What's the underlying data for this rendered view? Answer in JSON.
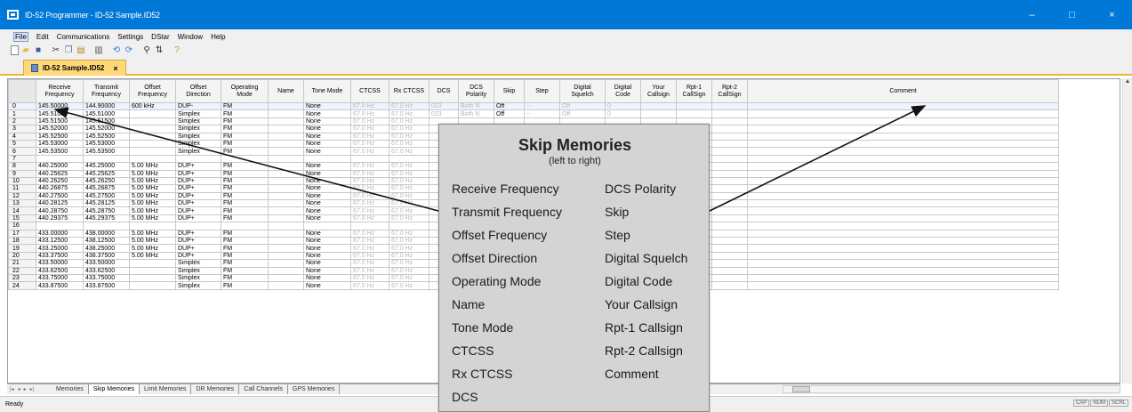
{
  "window": {
    "title": "ID-52 Programmer - ID-52 Sample.ID52",
    "minimize": "–",
    "maximize": "□",
    "close": "×"
  },
  "menu": [
    "File",
    "Edit",
    "Communications",
    "Settings",
    "DStar",
    "Window",
    "Help"
  ],
  "toolbar": [
    "new-icon",
    "open-icon",
    "save-icon",
    "cut-icon",
    "copy-icon",
    "paste-icon",
    "print-icon",
    "read-icon",
    "write-icon",
    "find-icon",
    "sort-icon",
    "help-icon"
  ],
  "doc_tab": {
    "label": "ID-52 Sample.ID52",
    "close": "×"
  },
  "grid": {
    "columns": [
      "Receive Frequency",
      "Transmit Frequency",
      "Offset Frequency",
      "Offset Direction",
      "Operating Mode",
      "Name",
      "Tone Mode",
      "CTCSS",
      "Rx CTCSS",
      "DCS",
      "DCS Polarity",
      "Skip",
      "Step",
      "Digital Squelch",
      "Digital Code",
      "Your Callsign",
      "Rpt-1 CallSign",
      "Rpt-2 CallSign",
      "Comment"
    ],
    "rows": [
      {
        "n": "0",
        "rx": "145.50000",
        "tx": "144.90000",
        "off": "600 kHz",
        "dir": "DUP-",
        "mode": "FM",
        "tone": "None",
        "ctcss": "67.0 Hz",
        "rxctcss": "67.0 Hz",
        "dcs": "023",
        "pol": "Both N",
        "skip": "Off",
        "step": "--",
        "dsq": "Off",
        "dcode": "0"
      },
      {
        "n": "1",
        "rx": "145.51000",
        "tx": "145.51000",
        "off": "",
        "dir": "Simplex",
        "mode": "FM",
        "tone": "None",
        "ctcss": "67.0 Hz",
        "rxctcss": "67.0 Hz",
        "dcs": "023",
        "pol": "Both N",
        "skip": "Off",
        "step": "--",
        "dsq": "Off",
        "dcode": "0"
      },
      {
        "n": "2",
        "rx": "145.51500",
        "tx": "145.51500",
        "off": "",
        "dir": "Simplex",
        "mode": "FM",
        "tone": "None",
        "ctcss": "67.0 Hz",
        "rxctcss": "67.0 Hz",
        "dcs": "",
        "pol": "",
        "skip": "",
        "step": "",
        "dsq": "",
        "dcode": ""
      },
      {
        "n": "3",
        "rx": "145.52000",
        "tx": "145.52000",
        "off": "",
        "dir": "Simplex",
        "mode": "FM",
        "tone": "None",
        "ctcss": "67.0 Hz",
        "rxctcss": "67.0 Hz",
        "dcs": "",
        "pol": "",
        "skip": "",
        "step": "",
        "dsq": "",
        "dcode": ""
      },
      {
        "n": "4",
        "rx": "145.52500",
        "tx": "145.52500",
        "off": "",
        "dir": "Simplex",
        "mode": "FM",
        "tone": "None",
        "ctcss": "67.0 Hz",
        "rxctcss": "67.0 Hz",
        "dcs": "",
        "pol": "",
        "skip": "",
        "step": "",
        "dsq": "",
        "dcode": ""
      },
      {
        "n": "5",
        "rx": "145.53000",
        "tx": "145.53000",
        "off": "",
        "dir": "Simplex",
        "mode": "FM",
        "tone": "None",
        "ctcss": "67.0 Hz",
        "rxctcss": "67.0 Hz",
        "dcs": "",
        "pol": "",
        "skip": "",
        "step": "",
        "dsq": "",
        "dcode": ""
      },
      {
        "n": "6",
        "rx": "145.53500",
        "tx": "145.53500",
        "off": "",
        "dir": "Simplex",
        "mode": "FM",
        "tone": "None",
        "ctcss": "67.0 Hz",
        "rxctcss": "67.0 Hz",
        "dcs": "",
        "pol": "",
        "skip": "",
        "step": "",
        "dsq": "",
        "dcode": ""
      },
      {
        "n": "7",
        "rx": "",
        "tx": "",
        "off": "",
        "dir": "",
        "mode": "",
        "tone": "",
        "ctcss": "",
        "rxctcss": "",
        "dcs": "",
        "pol": "",
        "skip": "",
        "step": "",
        "dsq": "",
        "dcode": ""
      },
      {
        "n": "8",
        "rx": "440.25000",
        "tx": "445.25000",
        "off": "5.00 MHz",
        "dir": "DUP+",
        "mode": "FM",
        "tone": "None",
        "ctcss": "67.0 Hz",
        "rxctcss": "67.0 Hz",
        "dcs": "",
        "pol": "",
        "skip": "",
        "step": "",
        "dsq": "",
        "dcode": ""
      },
      {
        "n": "9",
        "rx": "440.25625",
        "tx": "445.25625",
        "off": "5.00 MHz",
        "dir": "DUP+",
        "mode": "FM",
        "tone": "None",
        "ctcss": "67.0 Hz",
        "rxctcss": "67.0 Hz",
        "dcs": "",
        "pol": "",
        "skip": "",
        "step": "",
        "dsq": "",
        "dcode": ""
      },
      {
        "n": "10",
        "rx": "440.26250",
        "tx": "445.26250",
        "off": "5.00 MHz",
        "dir": "DUP+",
        "mode": "FM",
        "tone": "None",
        "ctcss": "67.0 Hz",
        "rxctcss": "67.0 Hz",
        "dcs": "",
        "pol": "",
        "skip": "",
        "step": "",
        "dsq": "",
        "dcode": ""
      },
      {
        "n": "11",
        "rx": "440.26875",
        "tx": "445.26875",
        "off": "5.00 MHz",
        "dir": "DUP+",
        "mode": "FM",
        "tone": "None",
        "ctcss": "67.0 Hz",
        "rxctcss": "67.0 Hz",
        "dcs": "",
        "pol": "",
        "skip": "",
        "step": "",
        "dsq": "",
        "dcode": ""
      },
      {
        "n": "12",
        "rx": "440.27500",
        "tx": "445.27500",
        "off": "5.00 MHz",
        "dir": "DUP+",
        "mode": "FM",
        "tone": "None",
        "ctcss": "67.0 Hz",
        "rxctcss": "67.0 Hz",
        "dcs": "",
        "pol": "",
        "skip": "",
        "step": "",
        "dsq": "",
        "dcode": ""
      },
      {
        "n": "13",
        "rx": "440.28125",
        "tx": "445.28125",
        "off": "5.00 MHz",
        "dir": "DUP+",
        "mode": "FM",
        "tone": "None",
        "ctcss": "67.0 Hz",
        "rxctcss": "67.0 Hz",
        "dcs": "",
        "pol": "",
        "skip": "",
        "step": "",
        "dsq": "",
        "dcode": ""
      },
      {
        "n": "14",
        "rx": "440.28750",
        "tx": "445.28750",
        "off": "5.00 MHz",
        "dir": "DUP+",
        "mode": "FM",
        "tone": "None",
        "ctcss": "67.0 Hz",
        "rxctcss": "67.0 Hz",
        "dcs": "",
        "pol": "",
        "skip": "",
        "step": "",
        "dsq": "",
        "dcode": ""
      },
      {
        "n": "15",
        "rx": "440.29375",
        "tx": "445.29375",
        "off": "5.00 MHz",
        "dir": "DUP+",
        "mode": "FM",
        "tone": "None",
        "ctcss": "67.0 Hz",
        "rxctcss": "67.0 Hz",
        "dcs": "",
        "pol": "",
        "skip": "",
        "step": "",
        "dsq": "",
        "dcode": ""
      },
      {
        "n": "16",
        "rx": "",
        "tx": "",
        "off": "",
        "dir": "",
        "mode": "",
        "tone": "",
        "ctcss": "",
        "rxctcss": "",
        "dcs": "",
        "pol": "",
        "skip": "",
        "step": "",
        "dsq": "",
        "dcode": ""
      },
      {
        "n": "17",
        "rx": "433.00000",
        "tx": "438.00000",
        "off": "5.00 MHz",
        "dir": "DUP+",
        "mode": "FM",
        "tone": "None",
        "ctcss": "67.0 Hz",
        "rxctcss": "67.0 Hz",
        "dcs": "",
        "pol": "",
        "skip": "",
        "step": "",
        "dsq": "",
        "dcode": ""
      },
      {
        "n": "18",
        "rx": "433.12500",
        "tx": "438.12500",
        "off": "5.00 MHz",
        "dir": "DUP+",
        "mode": "FM",
        "tone": "None",
        "ctcss": "67.0 Hz",
        "rxctcss": "67.0 Hz",
        "dcs": "",
        "pol": "",
        "skip": "",
        "step": "",
        "dsq": "",
        "dcode": ""
      },
      {
        "n": "19",
        "rx": "433.25000",
        "tx": "438.25000",
        "off": "5.00 MHz",
        "dir": "DUP+",
        "mode": "FM",
        "tone": "None",
        "ctcss": "67.0 Hz",
        "rxctcss": "67.0 Hz",
        "dcs": "",
        "pol": "",
        "skip": "",
        "step": "",
        "dsq": "",
        "dcode": ""
      },
      {
        "n": "20",
        "rx": "433.37500",
        "tx": "438.37500",
        "off": "5.00 MHz",
        "dir": "DUP+",
        "mode": "FM",
        "tone": "None",
        "ctcss": "67.0 Hz",
        "rxctcss": "67.0 Hz",
        "dcs": "",
        "pol": "",
        "skip": "",
        "step": "",
        "dsq": "",
        "dcode": ""
      },
      {
        "n": "21",
        "rx": "433.50000",
        "tx": "433.50000",
        "off": "",
        "dir": "Simplex",
        "mode": "FM",
        "tone": "None",
        "ctcss": "67.0 Hz",
        "rxctcss": "67.0 Hz",
        "dcs": "",
        "pol": "",
        "skip": "",
        "step": "",
        "dsq": "",
        "dcode": ""
      },
      {
        "n": "22",
        "rx": "433.62500",
        "tx": "433.62500",
        "off": "",
        "dir": "Simplex",
        "mode": "FM",
        "tone": "None",
        "ctcss": "67.0 Hz",
        "rxctcss": "67.0 Hz",
        "dcs": "",
        "pol": "",
        "skip": "",
        "step": "",
        "dsq": "",
        "dcode": ""
      },
      {
        "n": "23",
        "rx": "433.75000",
        "tx": "433.75000",
        "off": "",
        "dir": "Simplex",
        "mode": "FM",
        "tone": "None",
        "ctcss": "67.0 Hz",
        "rxctcss": "67.0 Hz",
        "dcs": "",
        "pol": "",
        "skip": "",
        "step": "",
        "dsq": "",
        "dcode": ""
      },
      {
        "n": "24",
        "rx": "433.87500",
        "tx": "433.87500",
        "off": "",
        "dir": "Simplex",
        "mode": "FM",
        "tone": "None",
        "ctcss": "67.0 Hz",
        "rxctcss": "67.0 Hz",
        "dcs": "",
        "pol": "",
        "skip": "",
        "step": "",
        "dsq": "",
        "dcode": ""
      }
    ]
  },
  "sheet_tabs": {
    "nav": [
      "|◂",
      "◂",
      "▸",
      "▸|"
    ],
    "tabs": [
      "Memories",
      "Skip Memories",
      "Limit Memories",
      "DR Memories",
      "Call Channels",
      "GPS Memories"
    ],
    "active": 1
  },
  "status": {
    "text": "Ready",
    "indicators": [
      "CAP",
      "NUM",
      "SCRL"
    ]
  },
  "overlay": {
    "title": "Skip Memories",
    "subtitle": "(left to right)",
    "left": [
      "Receive Frequency",
      "Transmit Frequency",
      "Offset Frequency",
      "Offset Direction",
      "Operating Mode",
      "Name",
      "Tone Mode",
      "CTCSS",
      "Rx CTCSS",
      "DCS"
    ],
    "right": [
      "DCS Polarity",
      "Skip",
      "Step",
      "Digital Squelch",
      "Digital Code",
      "Your Callsign",
      "Rpt-1 Callsign",
      "Rpt-2 Callsign",
      "Comment"
    ]
  },
  "colors": {
    "titlebar": "#0078d7",
    "doc_tab": "#ffd87a",
    "overlay_bg": "#d4d4d4",
    "arrow": "#111111"
  }
}
